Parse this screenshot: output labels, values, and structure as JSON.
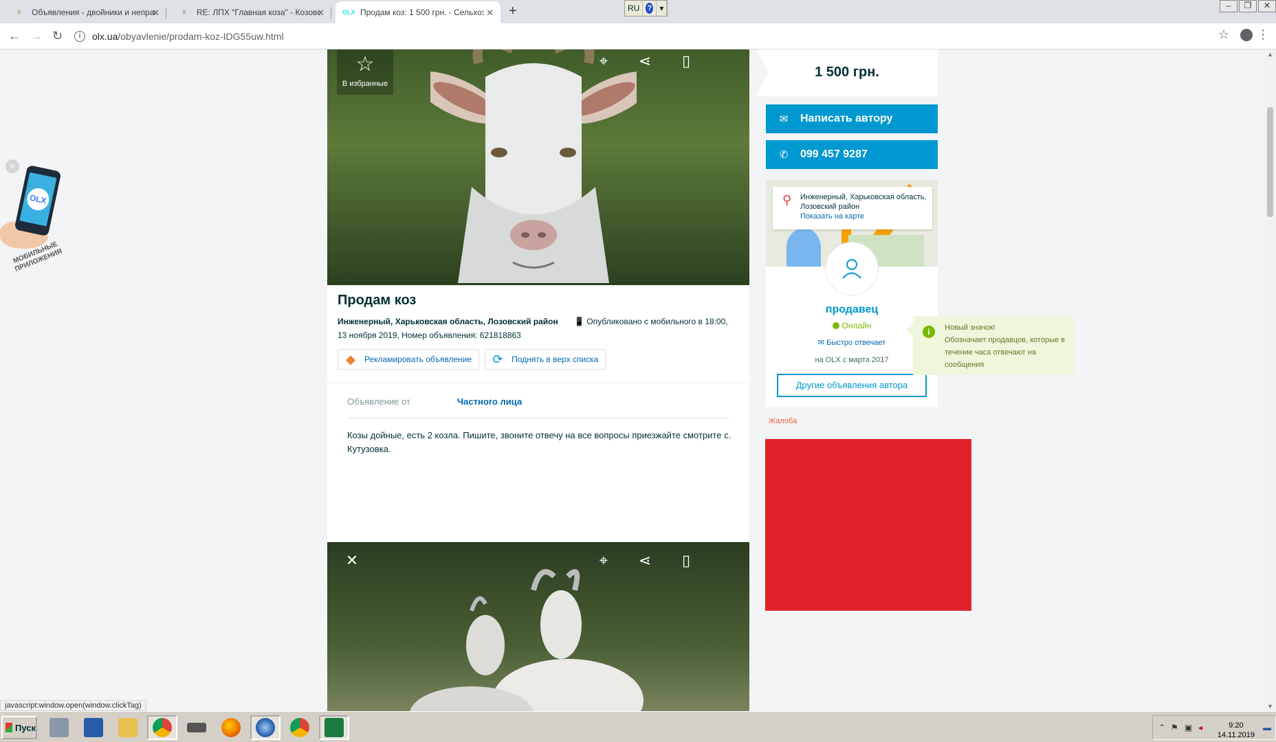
{
  "browser": {
    "tabs": [
      {
        "title": "Объявления - двойники и неправд",
        "active": false
      },
      {
        "title": "RE: ЛПХ \"Главная коза\" - Козовод",
        "active": false
      },
      {
        "title": "Продам коз: 1 500 грн. - Сельхоз",
        "active": true
      }
    ],
    "new_tab": "+",
    "lang": "RU",
    "help": "?",
    "url_host": "olx.ua",
    "url_path": "/obyavlenie/prodam-koz-IDG55uw.html"
  },
  "promo": {
    "close": "×",
    "logo": "OLX",
    "caption": "МОБИЛЬНЫЕ ПРИЛОЖЕНИЯ"
  },
  "photo": {
    "favorite_label": "В избранные",
    "favorite_icon": "star-icon"
  },
  "listing": {
    "title": "Продам коз",
    "location": "Инженерный, Харьковская область, Лозовский район",
    "published": "Опубликовано с мобильного",
    "published_time": "в 18:00,",
    "published_date": "13 ноября 2019, Номер объявления: 621818863",
    "promote_label": "Рекламировать объявление",
    "raise_label": "Поднять в верх списка",
    "from_key": "Объявление от",
    "from_value": "Частного лица",
    "description": "Козы дойные, есть 2 козла. Пишите, звоните отвечу на все вопросы приезжайте смотрите с. Кутузовка."
  },
  "sidebar": {
    "price": "1 500 грн.",
    "write_label": "Написать автору",
    "phone": "099 457 9287",
    "map_location": "Инженерный, Харьковская область, Лозовский район",
    "map_link": "Показать на карте",
    "seller_name": "продавец",
    "online": "Онлайн",
    "fast_reply": "Быстро отвечает",
    "member_since": "на OLX с марта 2017",
    "other_ads": "Другие объявления автора",
    "complaint": "Жалоба"
  },
  "tooltip": {
    "title": "Новый значок!",
    "text": "Обозначает продавцов, которые в течение часа отвечают на сообщения"
  },
  "statusbar": "javascript:window.open(window.clickTag)",
  "taskbar": {
    "start": "Пуск",
    "time": "9:20",
    "date": "14.11.2019"
  },
  "colors": {
    "olx_blue": "#0098d0",
    "online_green": "#7ab800",
    "ad_red": "#e0232b"
  }
}
